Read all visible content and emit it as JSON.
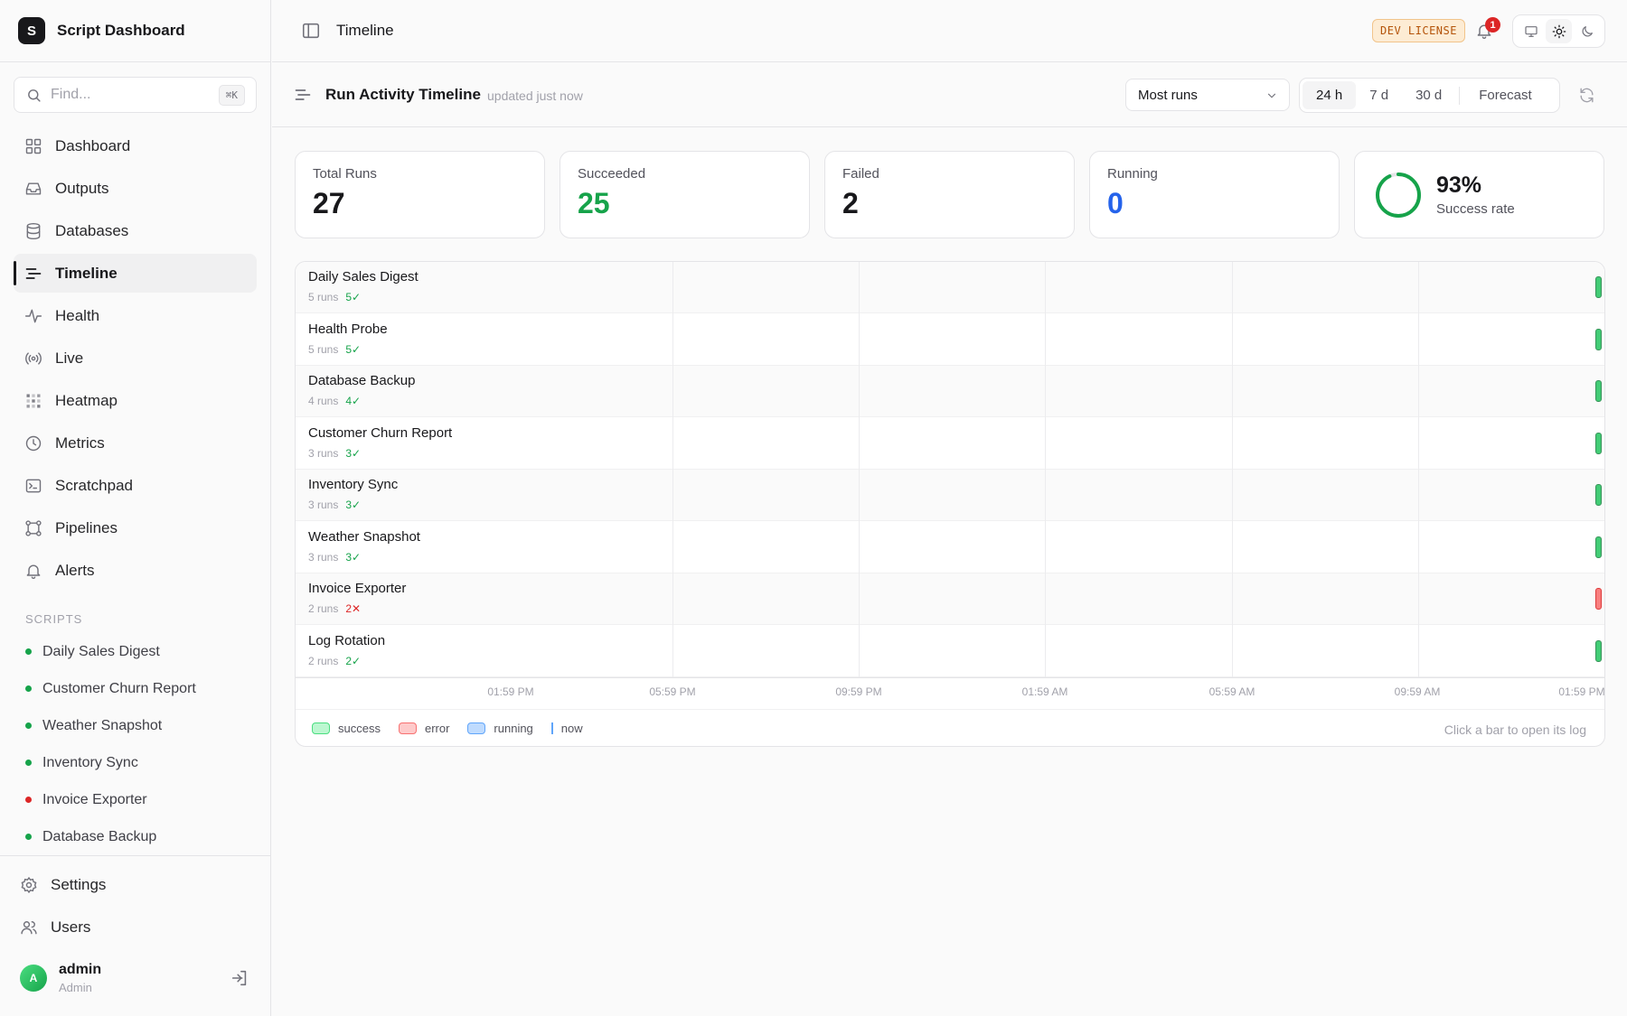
{
  "app": {
    "logo_letter": "S",
    "name": "Script Dashboard"
  },
  "search": {
    "placeholder": "Find...",
    "shortcut": "⌘K"
  },
  "nav": [
    {
      "label": "Dashboard",
      "icon": "grid-icon"
    },
    {
      "label": "Outputs",
      "icon": "inbox-icon"
    },
    {
      "label": "Databases",
      "icon": "database-icon"
    },
    {
      "label": "Timeline",
      "icon": "timeline-icon",
      "active": true
    },
    {
      "label": "Health",
      "icon": "pulse-icon"
    },
    {
      "label": "Live",
      "icon": "broadcast-icon"
    },
    {
      "label": "Heatmap",
      "icon": "heatmap-icon"
    },
    {
      "label": "Metrics",
      "icon": "clock-icon"
    },
    {
      "label": "Scratchpad",
      "icon": "terminal-icon"
    },
    {
      "label": "Pipelines",
      "icon": "pipeline-icon"
    },
    {
      "label": "Alerts",
      "icon": "bell-icon"
    }
  ],
  "scripts_section": {
    "label": "SCRIPTS",
    "items": [
      {
        "label": "Daily Sales Digest",
        "status_color": "#16a34a"
      },
      {
        "label": "Customer Churn Report",
        "status_color": "#16a34a"
      },
      {
        "label": "Weather Snapshot",
        "status_color": "#16a34a"
      },
      {
        "label": "Inventory Sync",
        "status_color": "#16a34a"
      },
      {
        "label": "Invoice Exporter",
        "status_color": "#dc2626"
      },
      {
        "label": "Database Backup",
        "status_color": "#16a34a"
      }
    ]
  },
  "bottom_nav": [
    {
      "label": "Settings",
      "icon": "gear-icon"
    },
    {
      "label": "Users",
      "icon": "users-icon"
    }
  ],
  "user": {
    "initial": "A",
    "name": "admin",
    "role": "Admin"
  },
  "topbar": {
    "title": "Timeline",
    "license": "DEV LICENSE",
    "notifications": "1"
  },
  "header": {
    "title": "Run Activity Timeline",
    "updated": "updated just now",
    "sort_value": "Most runs",
    "ranges": [
      {
        "label": "24 h",
        "active": true
      },
      {
        "label": "7 d"
      },
      {
        "label": "30 d"
      }
    ],
    "forecast_label": "Forecast"
  },
  "stats": {
    "total": {
      "label": "Total Runs",
      "value": "27"
    },
    "succeeded": {
      "label": "Succeeded",
      "value": "25"
    },
    "failed": {
      "label": "Failed",
      "value": "2"
    },
    "running": {
      "label": "Running",
      "value": "0"
    },
    "rate": {
      "value": "93%",
      "label": "Success rate",
      "fraction": 0.93
    }
  },
  "colors": {
    "success": "#16a34a",
    "error": "#dc2626",
    "running": "#2563eb",
    "accent": "#18181b"
  },
  "timeline": {
    "rows": [
      {
        "name": "Daily Sales Digest",
        "runs": "5 runs",
        "count": "5✓",
        "state": "success"
      },
      {
        "name": "Health Probe",
        "runs": "5 runs",
        "count": "5✓",
        "state": "success"
      },
      {
        "name": "Database Backup",
        "runs": "4 runs",
        "count": "4✓",
        "state": "success"
      },
      {
        "name": "Customer Churn Report",
        "runs": "3 runs",
        "count": "3✓",
        "state": "success"
      },
      {
        "name": "Inventory Sync",
        "runs": "3 runs",
        "count": "3✓",
        "state": "success"
      },
      {
        "name": "Weather Snapshot",
        "runs": "3 runs",
        "count": "3✓",
        "state": "success"
      },
      {
        "name": "Invoice Exporter",
        "runs": "2 runs",
        "count": "2✕",
        "state": "error"
      },
      {
        "name": "Log Rotation",
        "runs": "2 runs",
        "count": "2✓",
        "state": "success"
      }
    ],
    "ticks": [
      "01:59 PM",
      "05:59 PM",
      "09:59 PM",
      "01:59 AM",
      "05:59 AM",
      "09:59 AM",
      "01:59 PM"
    ],
    "legend": {
      "success": "success",
      "error": "error",
      "running": "running",
      "now": "now"
    },
    "hint": "Click a bar to open its log"
  }
}
